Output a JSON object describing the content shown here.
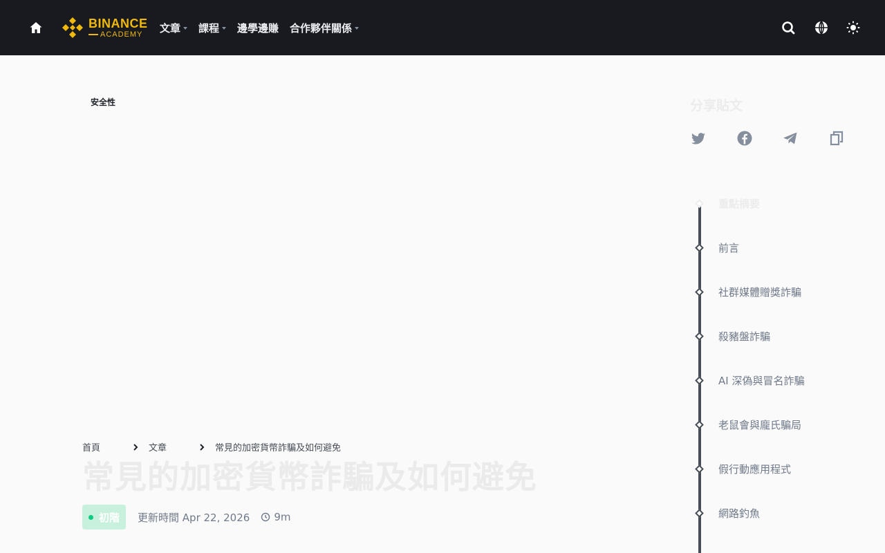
{
  "header": {
    "logo_main": "BINANCE",
    "logo_sub": "ACADEMY",
    "nav": [
      {
        "label": "文章",
        "dropdown": true
      },
      {
        "label": "課程",
        "dropdown": true
      },
      {
        "label": "邊學邊賺",
        "dropdown": false
      },
      {
        "label": "合作夥伴關係",
        "dropdown": true
      }
    ],
    "icons": [
      "home-icon",
      "search-icon",
      "globe-icon",
      "theme-toggle-icon"
    ]
  },
  "colors": {
    "header_bg": "#181a20",
    "brand": "#f0b90b",
    "beginner_badge_bg": "#c7f1dc",
    "beginner_dot": "#0ecb81"
  },
  "article": {
    "category": "安全性",
    "breadcrumb": [
      "首頁",
      "文章",
      "常見的加密貨幣詐騙及如何避免"
    ],
    "title": "常見的加密貨幣詐騙及如何避免",
    "level": "初階",
    "updated": "更新時間 Apr 22, 2026",
    "read_time": "9m"
  },
  "share": {
    "title": "分享貼文",
    "icons": [
      "twitter-icon",
      "facebook-icon",
      "telegram-icon",
      "copy-link-icon"
    ]
  },
  "toc": [
    {
      "label": "重點摘要",
      "active": true
    },
    {
      "label": "前言",
      "active": false
    },
    {
      "label": "社群媒體贈獎詐騙",
      "active": false
    },
    {
      "label": "殺豬盤詐騙",
      "active": false
    },
    {
      "label": "AI 深偽與冒名詐騙",
      "active": false
    },
    {
      "label": "老鼠會與龐氏騙局",
      "active": false
    },
    {
      "label": "假行動應用程式",
      "active": false
    },
    {
      "label": "網路釣魚",
      "active": false
    }
  ]
}
